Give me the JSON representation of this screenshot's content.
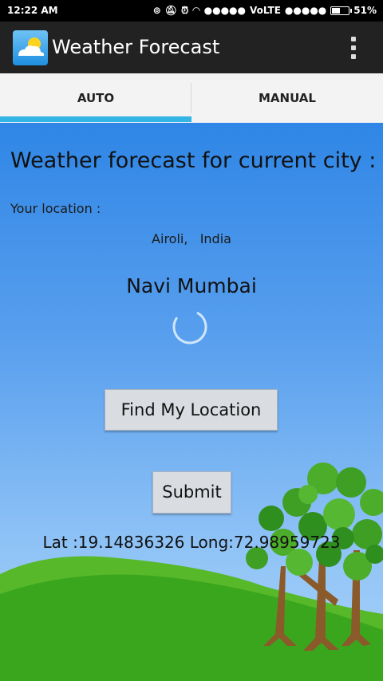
{
  "status_bar": {
    "time": "12:22 AM",
    "network_label": "VoLTE",
    "battery_percent": "51%",
    "battery_level": 0.51
  },
  "app_bar": {
    "title": "Weather Forecast",
    "icon": "weather-app-icon",
    "menu_icon": "overflow-menu-icon"
  },
  "tabs": [
    {
      "label": "AUTO",
      "selected": true
    },
    {
      "label": "MANUAL",
      "selected": false
    }
  ],
  "main": {
    "heading": "Weather forecast for current city :",
    "location_label": "Your location :",
    "location_value": "Airoli,   India",
    "city": "Navi Mumbai",
    "find_button": "Find My Location",
    "submit_button": "Submit",
    "lat_long": "Lat :19.14836326 Long:72.98959723"
  },
  "colors": {
    "accent": "#33b5e5",
    "sky_top": "#2f86e6",
    "sky_bottom": "#a9d3f8",
    "grass": "#3aa61d",
    "action_bar": "#222222"
  }
}
